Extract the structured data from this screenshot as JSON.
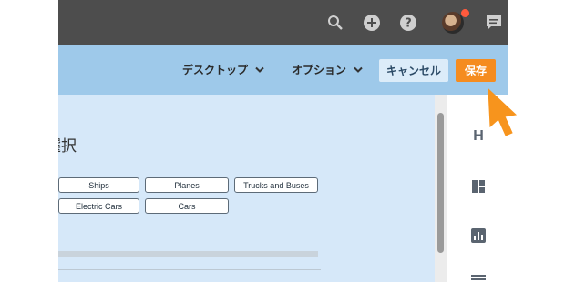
{
  "toolbar": {
    "desktop_label": "デスクトップ",
    "options_label": "オプション",
    "cancel_label": "キャンセル",
    "save_label": "保存"
  },
  "main": {
    "heading": "選択",
    "chips": [
      "Ships",
      "Planes",
      "Trucks and Buses",
      "Electric Cars",
      "Cars"
    ]
  },
  "side_panel": {
    "h_label": "H"
  },
  "topbar": {
    "icons": [
      "search-icon",
      "add-icon",
      "help-icon",
      "avatar",
      "chat-icon"
    ],
    "notification_color": "#ff5a3d"
  },
  "colors": {
    "accent": "#f58c1f",
    "editor_bar": "#9ec9ea",
    "canvas": "#d6e8f9"
  }
}
